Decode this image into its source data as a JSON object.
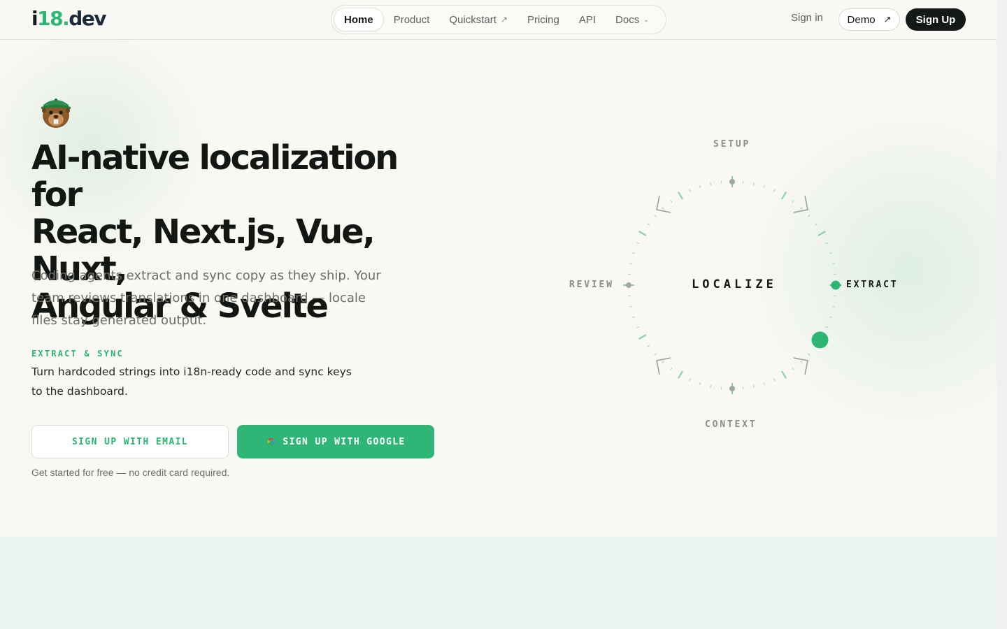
{
  "brand": {
    "logo_i": "i",
    "logo_num": "18",
    "logo_dot": ".",
    "logo_dev": "dev"
  },
  "nav": {
    "items": [
      {
        "label": "Home",
        "active": true
      },
      {
        "label": "Product"
      },
      {
        "label": "Quickstart",
        "external": true
      },
      {
        "label": "Pricing"
      },
      {
        "label": "API"
      },
      {
        "label": "Docs",
        "dropdown": true
      }
    ]
  },
  "header_actions": {
    "signin": "Sign in",
    "demo": "Demo",
    "signup": "Sign Up"
  },
  "hero": {
    "title_lines": [
      "AI-native localization for",
      "React, Next.js, Vue, Nuxt,",
      "Angular & Svelte"
    ],
    "subtitle": "Coding agents extract and sync copy as they ship. Your team reviews translations in one dashboard — locale files stay generated output.",
    "feature_label": "EXTRACT & SYNC",
    "feature_text": "Turn hardcoded strings into i18n-ready code and sync keys to the dashboard.",
    "cta_email": "SIGN UP WITH EMAIL",
    "cta_google": "SIGN UP WITH GOOGLE",
    "fineprint": "Get started for free — no credit card required."
  },
  "dial": {
    "center": "LOCALIZE",
    "stages": [
      {
        "label": "SETUP",
        "active": false
      },
      {
        "label": "EXTRACT",
        "active": true
      },
      {
        "label": "CONTEXT",
        "active": false
      },
      {
        "label": "REVIEW",
        "active": false
      }
    ]
  },
  "icons": {
    "quickstart": "arrow-up-right-icon",
    "docs": "chevron-down-icon",
    "demo": "arrow-up-right-icon",
    "google": "google-icon",
    "mascot": "beaver-mascot-icon"
  },
  "colors": {
    "accent": "#2bb673",
    "ink": "#141816",
    "muted": "#6b6e6a",
    "band": "#e8f4ed"
  }
}
